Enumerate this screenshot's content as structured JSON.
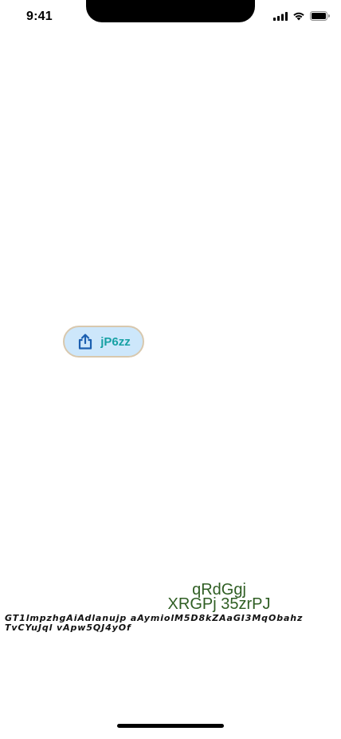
{
  "status_bar": {
    "time": "9:41",
    "signal_icon": "cellular-signal-icon",
    "wifi_icon": "wifi-icon",
    "battery_icon": "battery-icon"
  },
  "share_button": {
    "icon": "share-icon",
    "label": "jP6zz",
    "colors": {
      "background": "#cde7fb",
      "border": "#d8c8ae",
      "icon": "#1b5fb0",
      "label": "#17a1a4"
    }
  },
  "green_text": {
    "line1": "qRdGgj",
    "line2": "XRGPj 35zrPJ",
    "color": "#2f5e23"
  },
  "italic_text": {
    "line1": "GT1lmpzhgAiAdlanujp aAymiolM5D8kZAaGI3MqObahz",
    "line2": "TvCYuJql  vApw5QJ4yOf"
  }
}
